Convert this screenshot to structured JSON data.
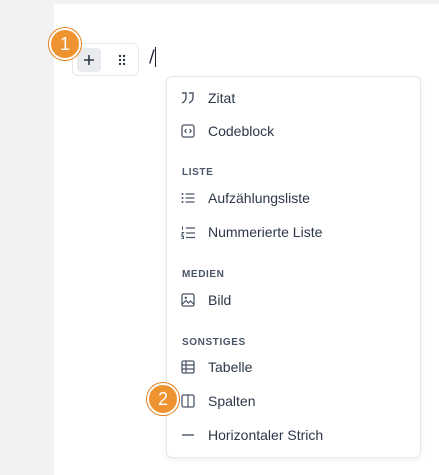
{
  "editor": {
    "typed_text": "/"
  },
  "badges": {
    "step_one": "1",
    "step_two": "2"
  },
  "menu": {
    "items_top": [
      {
        "label": "Zitat",
        "icon": "quote-icon"
      },
      {
        "label": "Codeblock",
        "icon": "code-block-icon"
      }
    ],
    "sections": [
      {
        "title": "LISTE",
        "items": [
          {
            "label": "Aufzählungsliste",
            "icon": "bullet-list-icon"
          },
          {
            "label": "Nummerierte Liste",
            "icon": "numbered-list-icon"
          }
        ]
      },
      {
        "title": "MEDIEN",
        "items": [
          {
            "label": "Bild",
            "icon": "image-icon"
          }
        ]
      },
      {
        "title": "SONSTIGES",
        "items": [
          {
            "label": "Tabelle",
            "icon": "table-icon"
          },
          {
            "label": "Spalten",
            "icon": "columns-icon"
          },
          {
            "label": "Horizontaler Strich",
            "icon": "horizontal-rule-icon"
          }
        ]
      }
    ]
  },
  "colors": {
    "badge": "#ef9330",
    "icon": "#4a5568",
    "text": "#2d3748"
  }
}
